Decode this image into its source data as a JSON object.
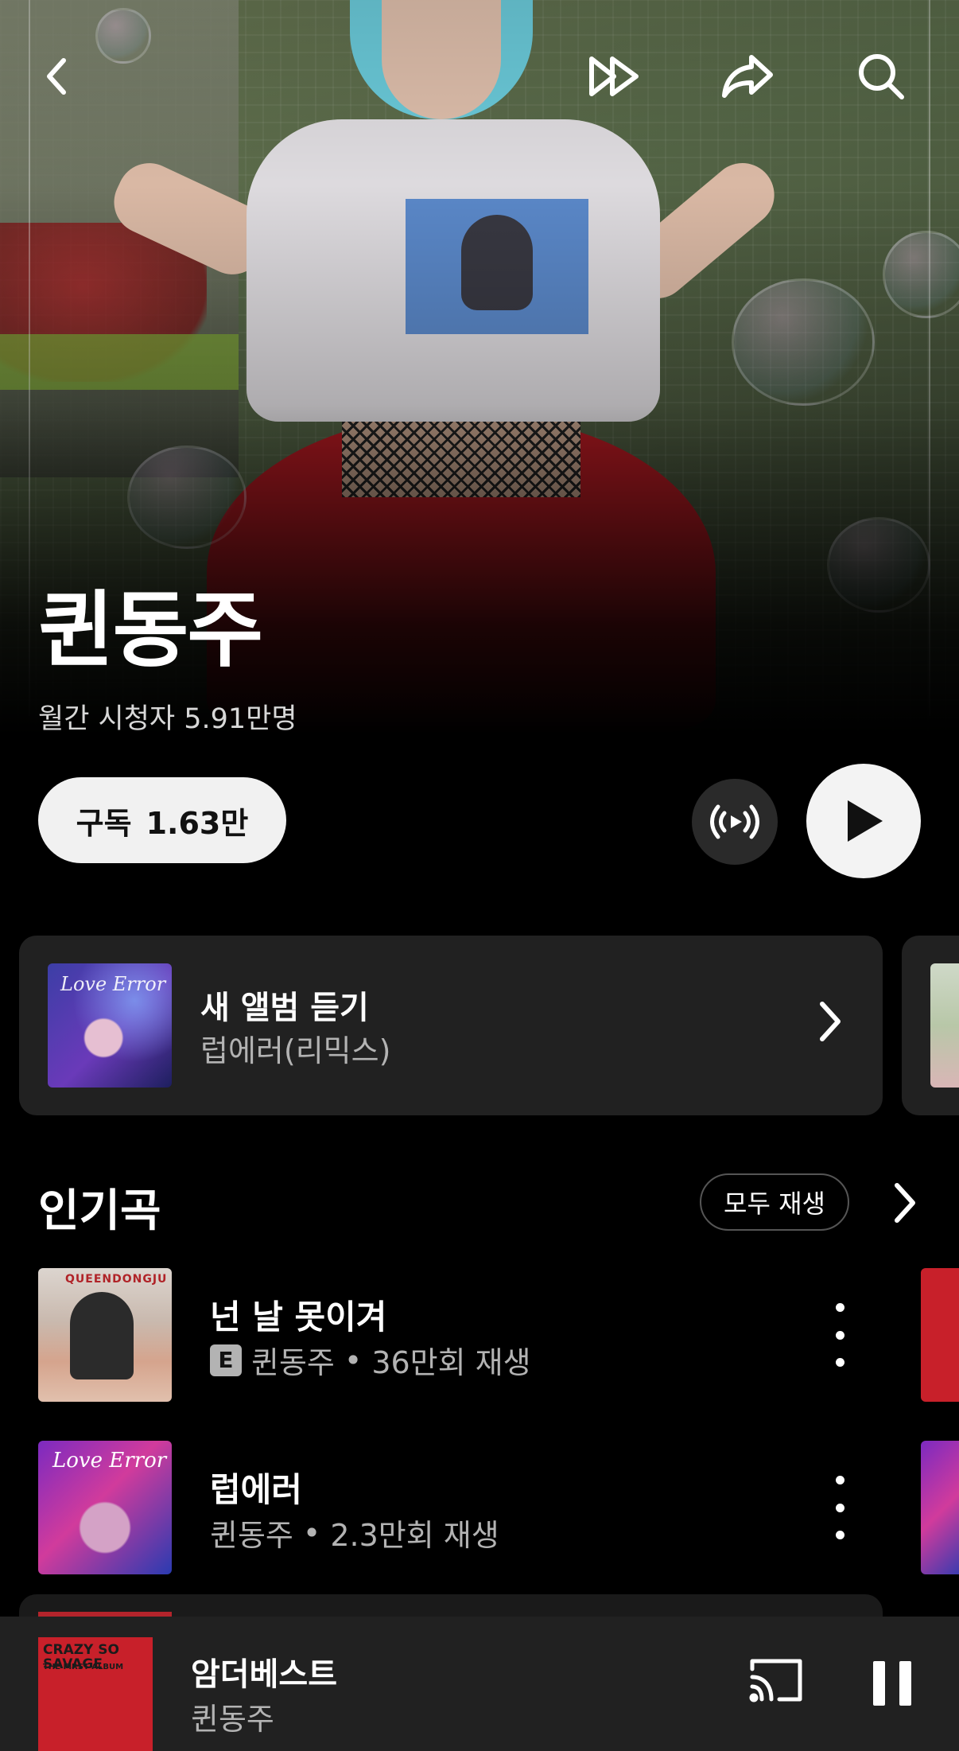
{
  "artist": {
    "name": "퀸동주",
    "monthly_listeners": "월간 시청자 5.91만명"
  },
  "actions": {
    "subscribe_label": "구독",
    "subscribe_count": "1.63만"
  },
  "new_album": {
    "title": "새 앨범 듣기",
    "album_name": "럽에러(리믹스)",
    "cover_text": "Love Error"
  },
  "popular": {
    "title": "인기곡",
    "play_all": "모두 재생",
    "songs": [
      {
        "title": "넌 날 못이겨",
        "explicit_badge": "E",
        "artist": "퀸동주",
        "plays": "36만회 재생",
        "cover_text": "QUEENDONGJU"
      },
      {
        "title": "럽에러",
        "artist": "퀸동주",
        "plays": "2.3만회 재생",
        "cover_text": "Love Error"
      }
    ],
    "separator": "•"
  },
  "now_playing": {
    "title": "암더베스트",
    "artist": "퀸동주",
    "cover_title": "CRAZY SO SAVAGE",
    "cover_sub": "THE FIRST ALBUM"
  },
  "icons": [
    "back-icon",
    "fast-forward-icon",
    "share-icon",
    "search-icon",
    "radio-icon",
    "play-icon",
    "chevron-right-icon",
    "more-vert-icon",
    "cast-icon",
    "pause-icon"
  ],
  "colors": {
    "background": "#000000",
    "card": "#212121",
    "secondary_text": "#b3b3b3",
    "pill": "#f1f1f1"
  }
}
